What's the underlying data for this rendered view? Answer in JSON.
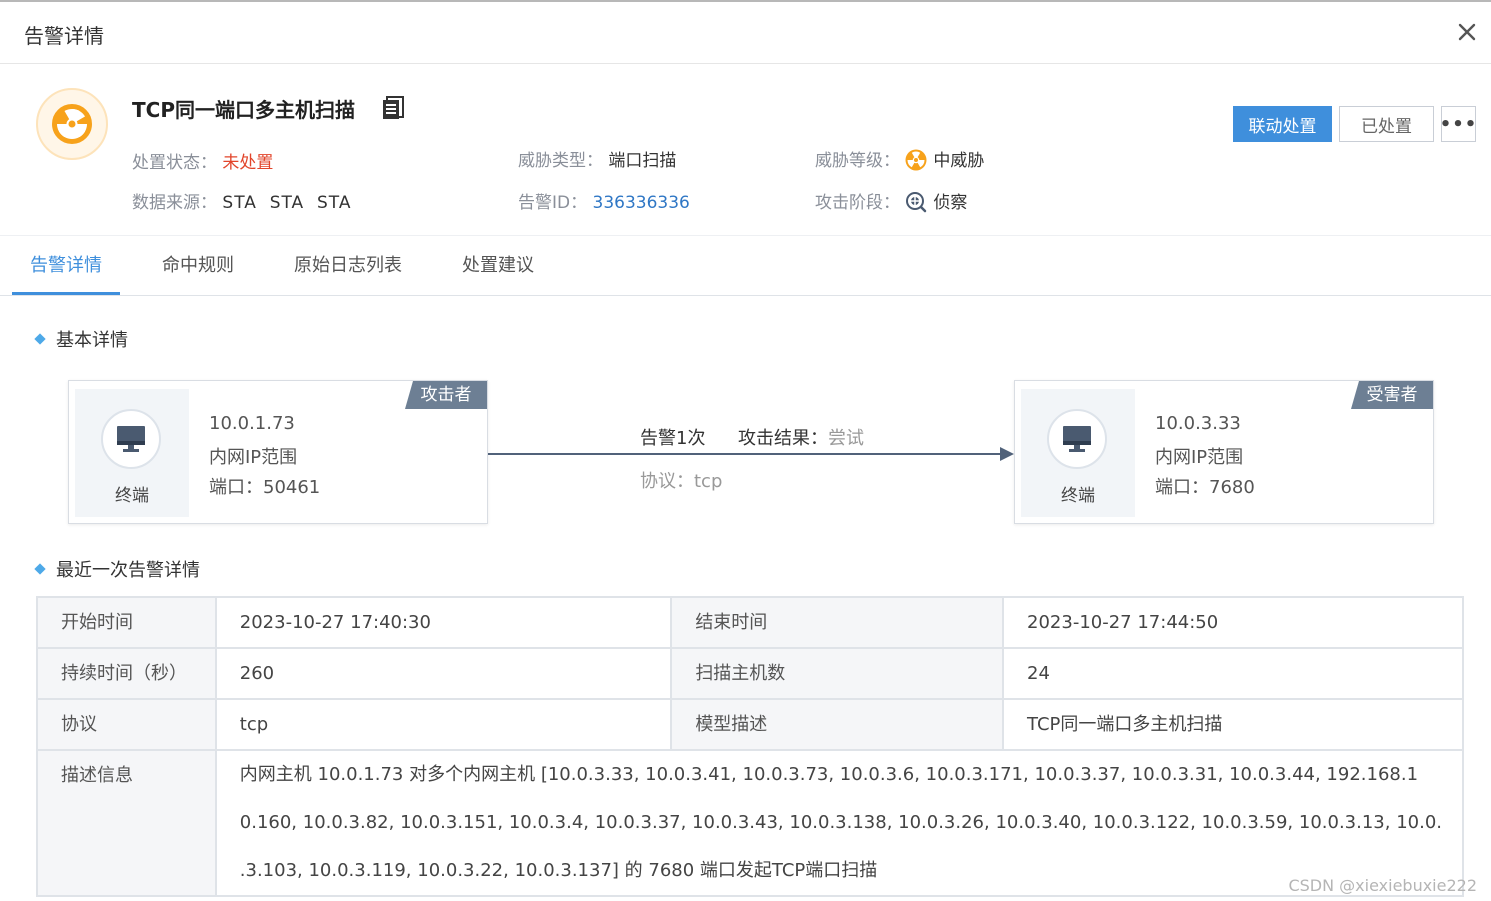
{
  "header": {
    "title": "告警详情"
  },
  "alert": {
    "title": "TCP同一端口多主机扫描",
    "fields": {
      "status": {
        "label": "处置状态：",
        "value": "未处置"
      },
      "source": {
        "label": "数据来源：",
        "value": "STA  STA  STA"
      },
      "threat_type": {
        "label": "威胁类型：",
        "value": "端口扫描"
      },
      "alert_id": {
        "label": "告警ID：",
        "value": "336336336"
      },
      "threat_level": {
        "label": "威胁等级：",
        "value": "中威胁"
      },
      "attack_stage": {
        "label": "攻击阶段：",
        "value": "侦察"
      }
    },
    "buttons": {
      "linkage": "联动处置",
      "handled": "已处置",
      "more": "•••"
    }
  },
  "tabs": [
    {
      "label": "告警详情",
      "active": true
    },
    {
      "label": "命中规则",
      "active": false
    },
    {
      "label": "原始日志列表",
      "active": false
    },
    {
      "label": "处置建议",
      "active": false
    }
  ],
  "basic": {
    "title": "基本详情",
    "attacker": {
      "role": "攻击者",
      "type": "终端",
      "ip": "10.0.1.73",
      "range": "内网IP范围",
      "port": "端口：50461"
    },
    "victim": {
      "role": "受害者",
      "type": "终端",
      "ip": "10.0.3.33",
      "range": "内网IP范围",
      "port": "端口：7680"
    },
    "link": {
      "count": "告警1次",
      "result_label": "攻击结果：",
      "result_value": "尝试",
      "protocol": "协议：tcp"
    }
  },
  "recent": {
    "title": "最近一次告警详情",
    "rows": [
      {
        "k1": "开始时间",
        "v1": "2023-10-27 17:40:30",
        "k2": "结束时间",
        "v2": "2023-10-27 17:44:50"
      },
      {
        "k1": "持续时间（秒）",
        "v1": "260",
        "k2": "扫描主机数",
        "v2": "24"
      },
      {
        "k1": "协议",
        "v1": "tcp",
        "k2": "模型描述",
        "v2": "TCP同一端口多主机扫描"
      }
    ],
    "desc_label": "描述信息",
    "desc_lines": [
      "内网主机 10.0.1.73 对多个内网主机 [10.0.3.33, 10.0.3.41, 10.0.3.73, 10.0.3.6, 10.0.3.171, 10.0.3.37, 10.0.3.31, 10.0.3.44, 192.168.1",
      "0.160, 10.0.3.82, 10.0.3.151, 10.0.3.4, 10.0.3.37, 10.0.3.43, 10.0.3.138, 10.0.3.26, 10.0.3.40, 10.0.3.122, 10.0.3.59, 10.0.3.13, 10.0.",
      ".3.103, 10.0.3.119, 10.0.3.22, 10.0.3.137] 的 7680 端口发起TCP端口扫描"
    ]
  },
  "watermark": "CSDN @xiexiebuxie222",
  "colors": {
    "accent": "#3f8fdc",
    "danger": "#e2452b",
    "warning": "#f7a21b",
    "role_tag": "#6d7f94"
  }
}
